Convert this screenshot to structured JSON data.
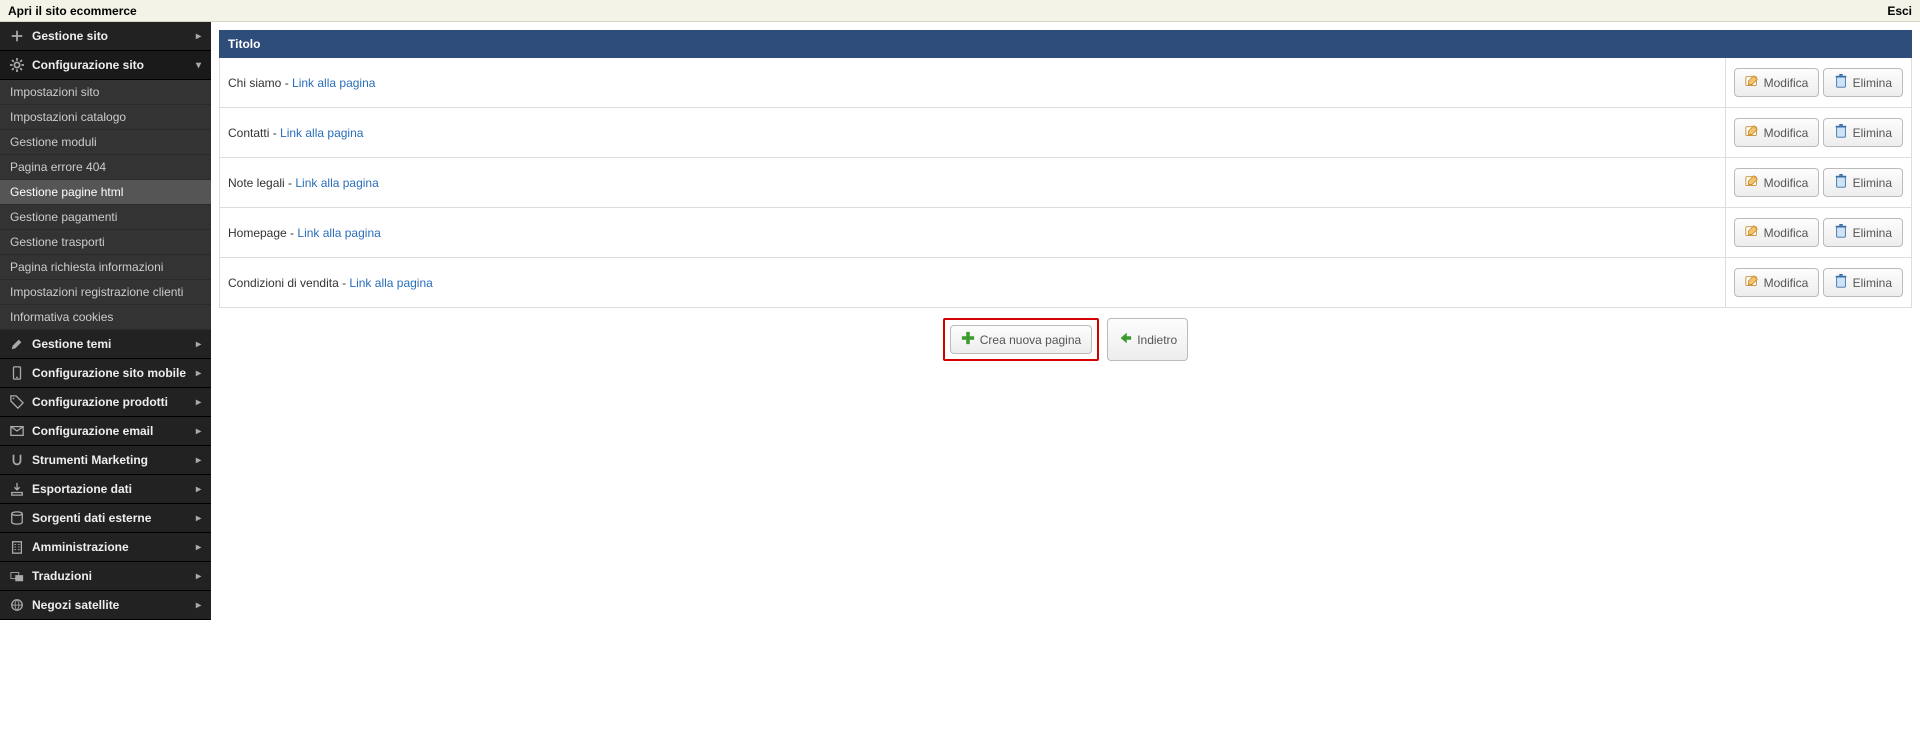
{
  "topbar": {
    "open_site": "Apri il sito ecommerce",
    "logout": "Esci"
  },
  "sidebar": {
    "groups": [
      {
        "label": "Gestione sito",
        "icon": "plus"
      },
      {
        "label": "Configurazione sito",
        "icon": "gear",
        "expanded": true
      },
      {
        "label": "Gestione temi",
        "icon": "brush"
      },
      {
        "label": "Configurazione sito mobile",
        "icon": "mobile"
      },
      {
        "label": "Configurazione prodotti",
        "icon": "tags"
      },
      {
        "label": "Configurazione email",
        "icon": "mail"
      },
      {
        "label": "Strumenti Marketing",
        "icon": "magnet"
      },
      {
        "label": "Esportazione dati",
        "icon": "export"
      },
      {
        "label": "Sorgenti dati esterne",
        "icon": "db"
      },
      {
        "label": "Amministrazione",
        "icon": "building"
      },
      {
        "label": "Traduzioni",
        "icon": "lang"
      },
      {
        "label": "Negozi satellite",
        "icon": "globe"
      }
    ],
    "submenu": [
      "Impostazioni sito",
      "Impostazioni catalogo",
      "Gestione moduli",
      "Pagina errore 404",
      "Gestione pagine html",
      "Gestione pagamenti",
      "Gestione trasporti",
      "Pagina richiesta informazioni",
      "Impostazioni registrazione clienti",
      "Informativa cookies"
    ],
    "submenu_active_index": 4
  },
  "table": {
    "header": "Titolo",
    "link_text": "Link alla pagina",
    "rows": [
      {
        "title": "Chi siamo"
      },
      {
        "title": "Contatti"
      },
      {
        "title": "Note legali"
      },
      {
        "title": "Homepage"
      },
      {
        "title": "Condizioni di vendita"
      }
    ],
    "modify_label": "Modifica",
    "delete_label": "Elimina"
  },
  "actions": {
    "create": "Crea nuova pagina",
    "back": "Indietro"
  }
}
